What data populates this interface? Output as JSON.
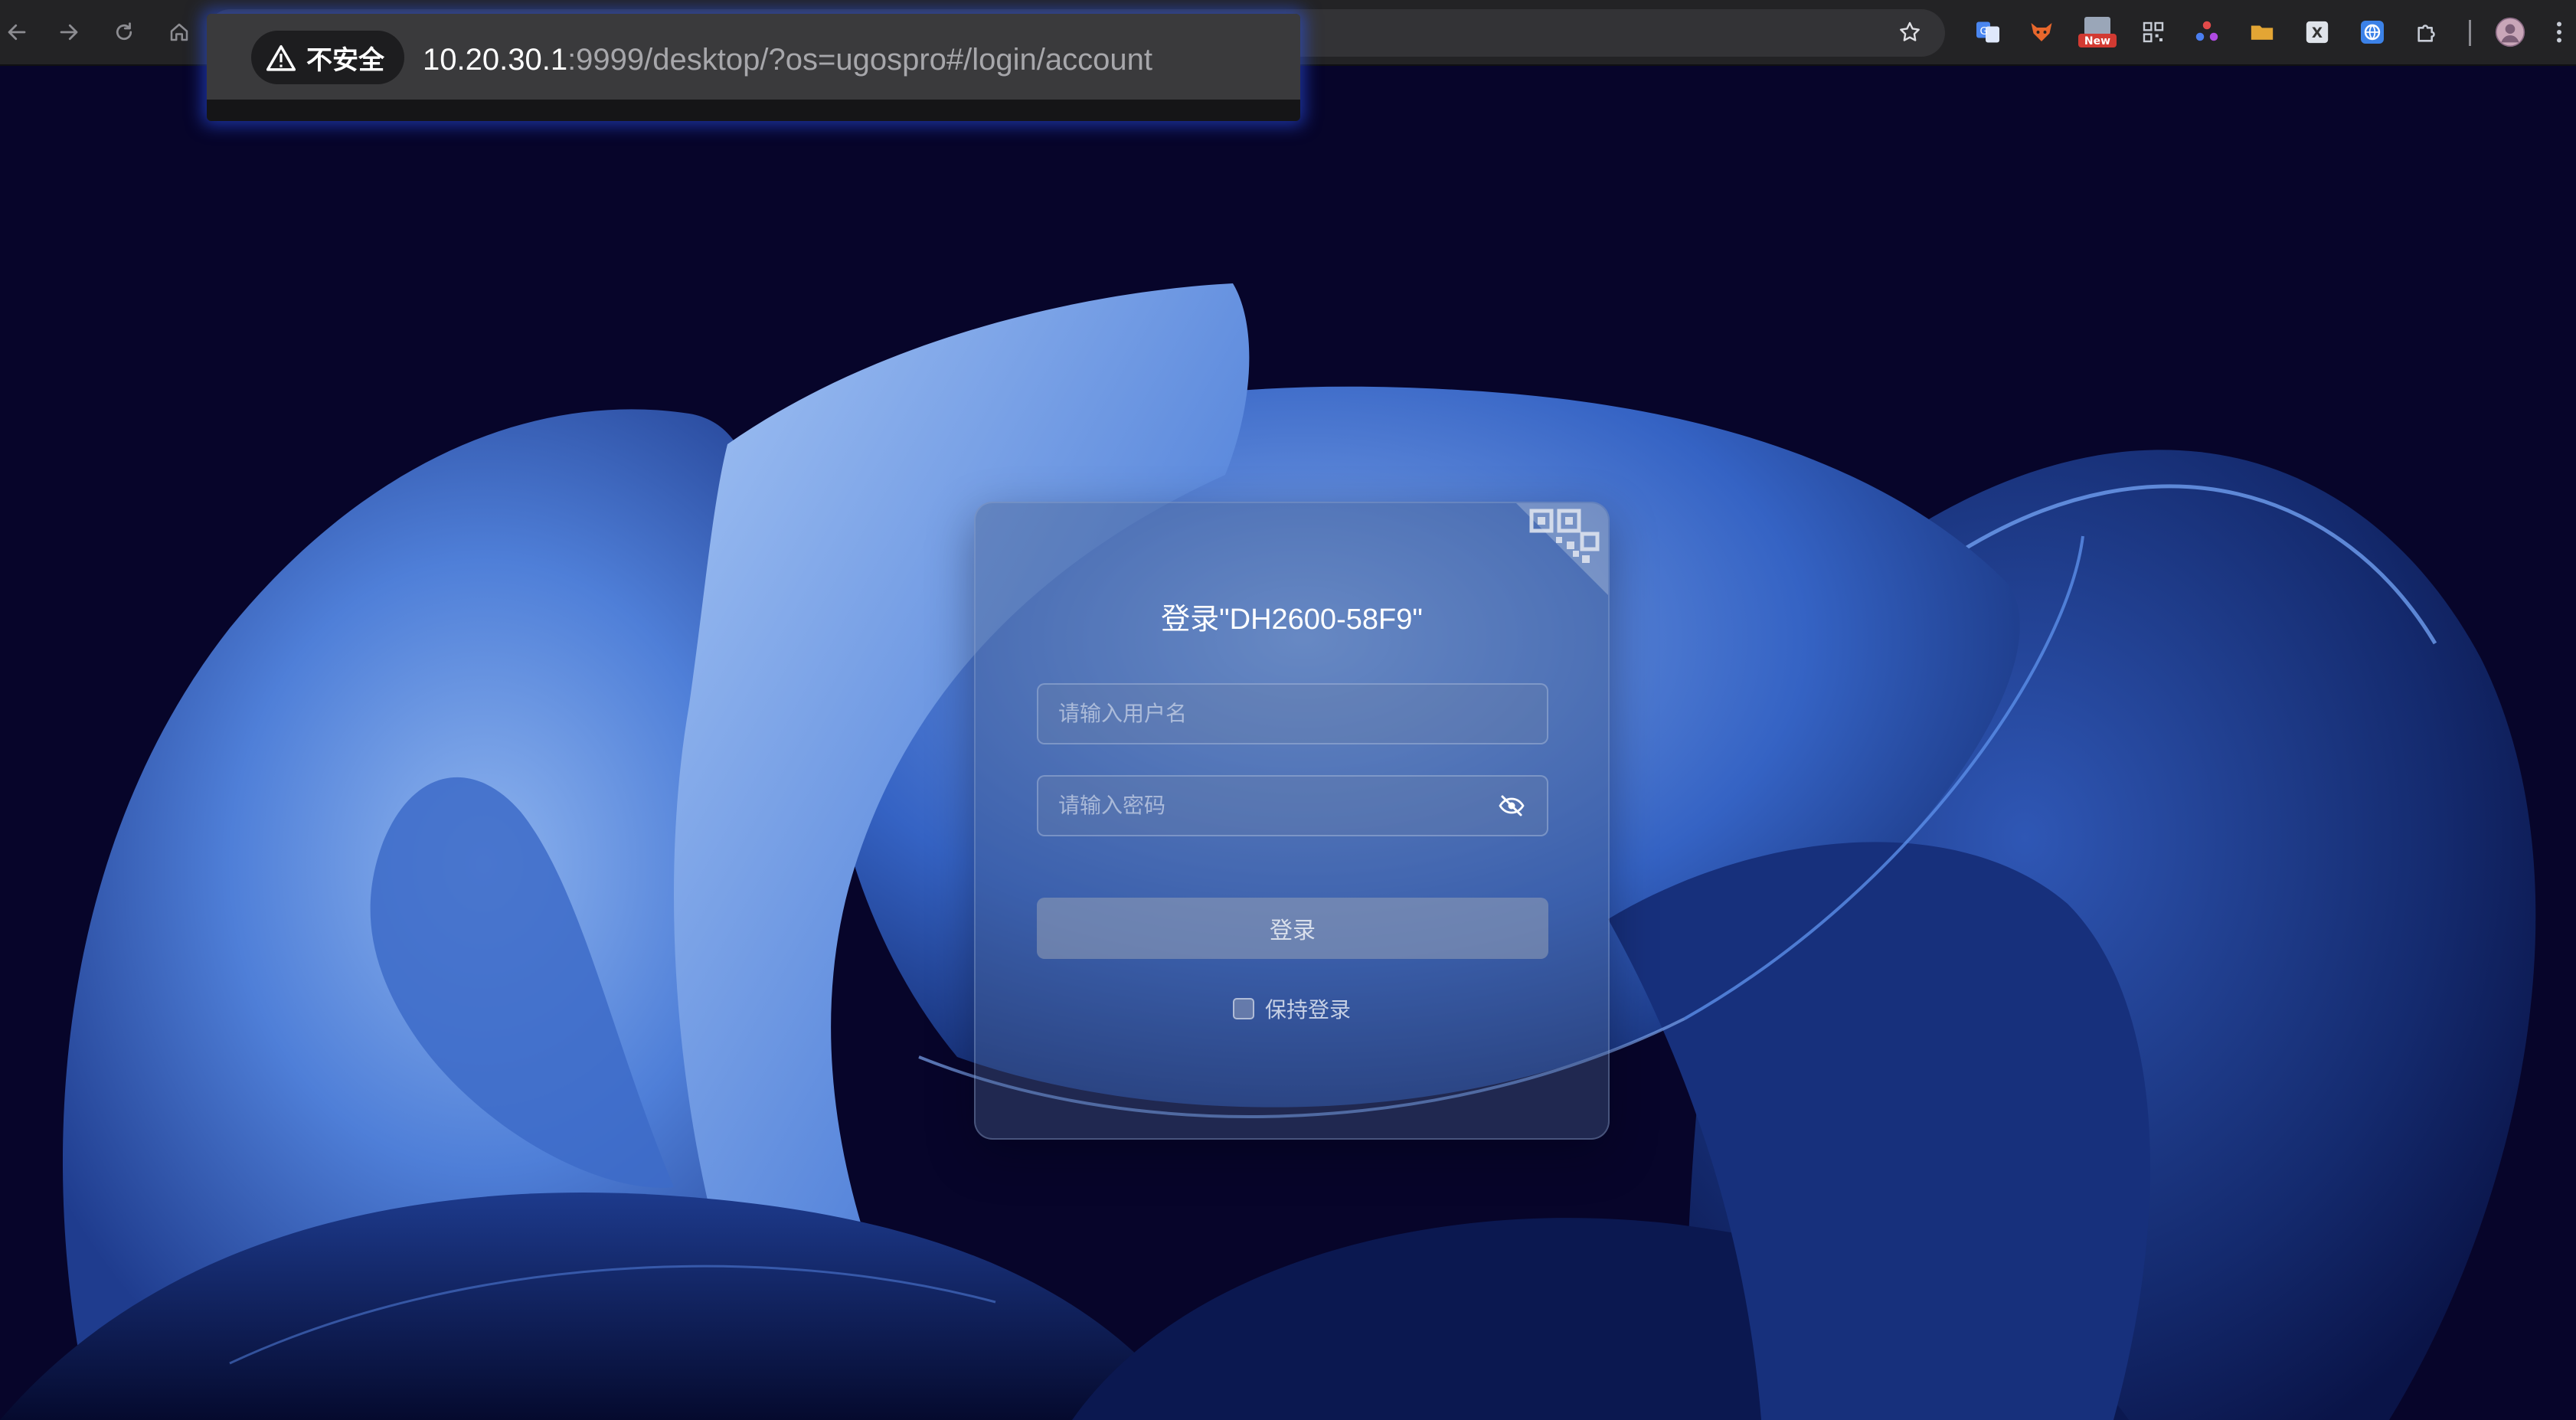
{
  "browser": {
    "security_label": "不安全",
    "url_host": "10.20.30.1",
    "url_rest": ":9999/desktop/?os=ugospro#/login/account",
    "extensions": [
      {
        "name": "translate-extension-icon"
      },
      {
        "name": "fox-extension-icon"
      },
      {
        "name": "new-badge-extension-icon",
        "badge": "New"
      },
      {
        "name": "qr-extension-icon"
      },
      {
        "name": "dots-extension-icon"
      },
      {
        "name": "folder-extension-icon"
      },
      {
        "name": "x-extension-icon",
        "label": "X"
      },
      {
        "name": "globe-extension-icon"
      },
      {
        "name": "puzzle-extension-icon"
      },
      {
        "name": "profile-avatar"
      }
    ]
  },
  "login": {
    "title": "登录\"DH2600-58F9\"",
    "username_placeholder": "请输入用户名",
    "password_placeholder": "请输入密码",
    "submit_label": "登录",
    "remember_label": "保持登录"
  },
  "colors": {
    "background": "#07052a",
    "wallpaper_blue": "#4f7fd8",
    "card_bg": "rgba(70,92,138,0.40)",
    "button_bg": "rgba(150,160,182,0.55)",
    "focus_glow": "#2d5aff"
  }
}
